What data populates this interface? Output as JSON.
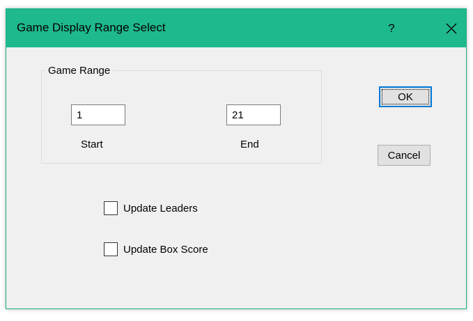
{
  "window": {
    "title": "Game Display Range Select",
    "help_glyph": "?",
    "close_icon": "close-icon",
    "titlebar_color": "#1fb98e"
  },
  "game_range": {
    "legend": "Game Range",
    "start": {
      "value": "1",
      "label": "Start"
    },
    "end": {
      "value": "21",
      "label": "End"
    }
  },
  "buttons": {
    "ok_label": "OK",
    "cancel_label": "Cancel"
  },
  "options": {
    "update_leaders": {
      "label": "Update Leaders",
      "checked": false
    },
    "update_box_score": {
      "label": "Update Box Score",
      "checked": false
    }
  }
}
